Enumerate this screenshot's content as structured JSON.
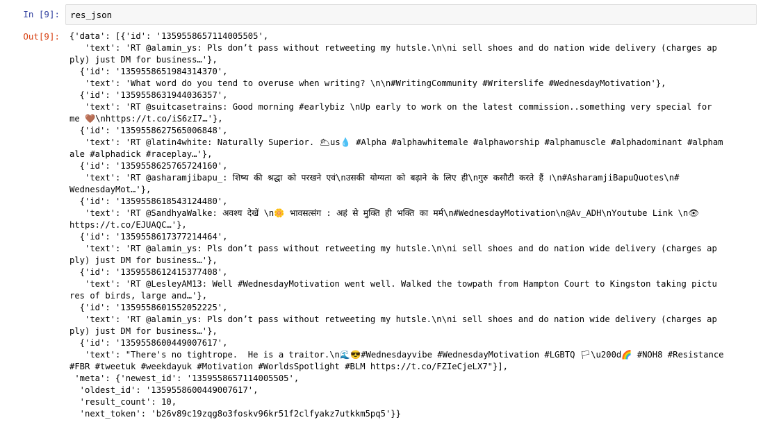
{
  "in_prompt": "In [9]:",
  "out_prompt": "Out[9]:",
  "input_code": "res_json",
  "output_lines": [
    "{'data': [{'id': '1359558657114005505',",
    "   'text': 'RT @alamin_ys: Pls don’t pass without retweeting my hutsle.\\n\\ni sell shoes and do nation wide delivery (charges ap",
    "ply) just DM for business…'},",
    "  {'id': '1359558651984314370',",
    "   'text': 'What word do you tend to overuse when writing? \\n\\n#WritingCommunity #Writerslife #WednesdayMotivation'},",
    "  {'id': '1359558631944036357',",
    "   'text': 'RT @suitcasetrains: Good morning #earlybiz \\nUp early to work on the latest commission..something very special for",
    "me 🤎\\nhttps://t.co/iS6zI7…'},",
    "  {'id': '1359558627565006848',",
    "   'text': 'RT @latin4white: Naturally Superior. 🌥us💧 #Alpha #alphawhitemale #alphaworship #alphamuscle #alphadominant #alpham",
    "ale #alphadick #raceplay…'},",
    "  {'id': '1359558625765724160',",
    "   'text': 'RT @asharamjibapu_: शिष्य की श्रद्धा को परखने एवं\\nउसकी योग्यता को बढ़ाने के लिए ही\\nगुरु कसौटी करते हैं ।\\n#AsharamjiBapuQuotes\\n#",
    "WednesdayMot…'},",
    "  {'id': '1359558618543124480',",
    "   'text': 'RT @SandhyaWalke: अवश्य देखें \\n🌼 भावसत्संग : अहं से मुक्ति ही भक्ति का मर्म\\n#WednesdayMotivation\\n@Av_ADH\\nYoutube Link \\n👁",
    "https://t.co/EJUAQC…'},",
    "  {'id': '1359558617377214464',",
    "   'text': 'RT @alamin_ys: Pls don’t pass without retweeting my hutsle.\\n\\ni sell shoes and do nation wide delivery (charges ap",
    "ply) just DM for business…'},",
    "  {'id': '1359558612415377408',",
    "   'text': 'RT @LesleyAM13: Well #WednesdayMotivation went well. Walked the towpath from Hampton Court to Kingston taking pictu",
    "res of birds, large and…'},",
    "  {'id': '1359558601552052225',",
    "   'text': 'RT @alamin_ys: Pls don’t pass without retweeting my hutsle.\\n\\ni sell shoes and do nation wide delivery (charges ap",
    "ply) just DM for business…'},",
    "  {'id': '1359558600449007617',",
    "   'text': \"There's no tightrope.  He is a traitor.\\n🌊😎#Wednesdayvibe #WednesdayMotivation #LGBTQ 🏳\\u200d🌈 #NOH8 #Resistance",
    "#FBR #tweetuk #weekdayuk #Motivation #WorldsSpotlight #BLM https://t.co/FZIeCjeLX7\"}],",
    " 'meta': {'newest_id': '1359558657114005505',",
    "  'oldest_id': '1359558600449007617',",
    "  'result_count': 10,",
    "  'next_token': 'b26v89c19zqg8o3foskv96kr51f2clfyakz7utkkm5pq5'}}"
  ]
}
